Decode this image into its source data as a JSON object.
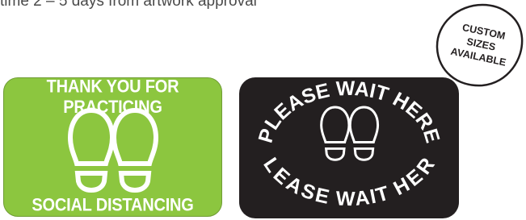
{
  "header": {
    "lead_time": "time 2 – 5 days from artwork approval"
  },
  "green_sticker": {
    "top_text": "THANK YOU FOR PRACTICING",
    "bottom_text": "SOCIAL DISTANCING",
    "background": "#8cc63f",
    "icon": "footprints-icon"
  },
  "black_sticker": {
    "top_text": "PLEASE WAIT HERE",
    "bottom_text": "PLEASE WAIT HERE",
    "background": "#231f20",
    "icon": "footprints-icon"
  },
  "badge": {
    "line1": "CUSTOM",
    "line2": "SIZES",
    "line3": "AVAILABLE"
  }
}
